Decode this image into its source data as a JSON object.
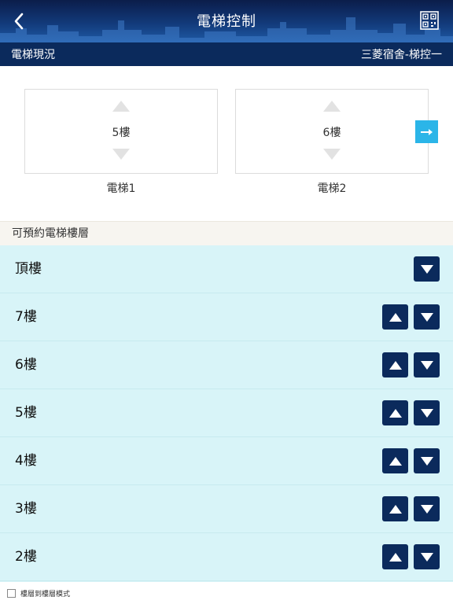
{
  "header": {
    "title": "電梯控制",
    "back_icon": "chevron-left-icon",
    "qr_icon": "qr-code-icon"
  },
  "status": {
    "label": "電梯現況",
    "building": "三菱宿舍-梯控一"
  },
  "cars": [
    {
      "floor": "5樓",
      "label": "電梯1"
    },
    {
      "floor": "6樓",
      "label": "電梯2"
    }
  ],
  "section": {
    "title": "可預約電梯樓層"
  },
  "floors": [
    {
      "name": "頂樓",
      "up": false,
      "down": true
    },
    {
      "name": "7樓",
      "up": true,
      "down": true
    },
    {
      "name": "6樓",
      "up": true,
      "down": true
    },
    {
      "name": "5樓",
      "up": true,
      "down": true
    },
    {
      "name": "4樓",
      "up": true,
      "down": true
    },
    {
      "name": "3樓",
      "up": true,
      "down": true
    },
    {
      "name": "2樓",
      "up": true,
      "down": true
    }
  ],
  "footer": {
    "mode_label": "樓層到樓層模式",
    "checked": false
  },
  "colors": {
    "navy": "#0b2a5c",
    "accent": "#2bb5e8",
    "list_bg": "#d8f4f8"
  }
}
